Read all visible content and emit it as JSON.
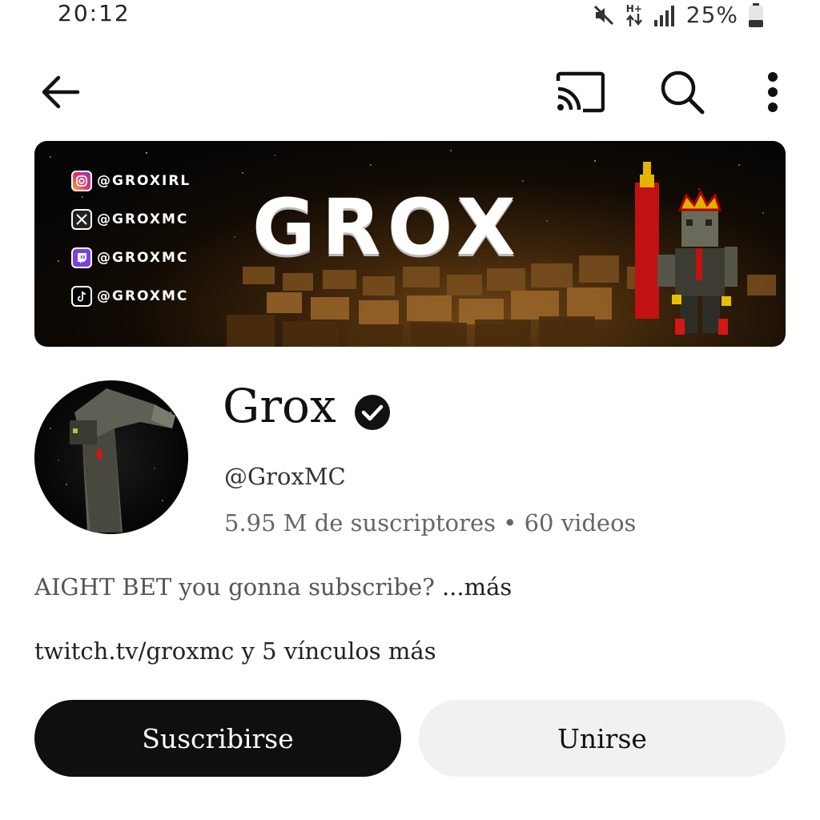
{
  "status_bar": {
    "time": "20:12",
    "network": "H+",
    "battery": "25%",
    "icons": [
      "mute-icon",
      "data-arrows-icon",
      "signal-icon",
      "battery-icon"
    ]
  },
  "top_bar": {
    "icons": [
      "back-arrow-icon",
      "cast-icon",
      "search-icon",
      "more-vert-icon"
    ]
  },
  "banner": {
    "title": "GROX",
    "socials": [
      {
        "platform": "instagram",
        "handle": "@GROXIRL"
      },
      {
        "platform": "x",
        "handle": "@GROXMC"
      },
      {
        "platform": "twitch",
        "handle": "@GROXMC"
      },
      {
        "platform": "tiktok",
        "handle": "@GROXMC"
      }
    ]
  },
  "channel": {
    "name": "Grox",
    "handle": "@GroxMC",
    "stats": "5.95 M de suscriptores • 60 videos",
    "description": "AIGHT BET you gonna subscribe?",
    "description_more": "...más",
    "links": "twitch.tv/groxmc y 5 vínculos más"
  },
  "actions": {
    "subscribe_label": "Suscribirse",
    "join_label": "Unirse"
  },
  "colors": {
    "primary_button": "#0f0f0f",
    "secondary_button": "#f1f1f1",
    "text": "#0f0f0f",
    "muted_text": "#666666"
  }
}
